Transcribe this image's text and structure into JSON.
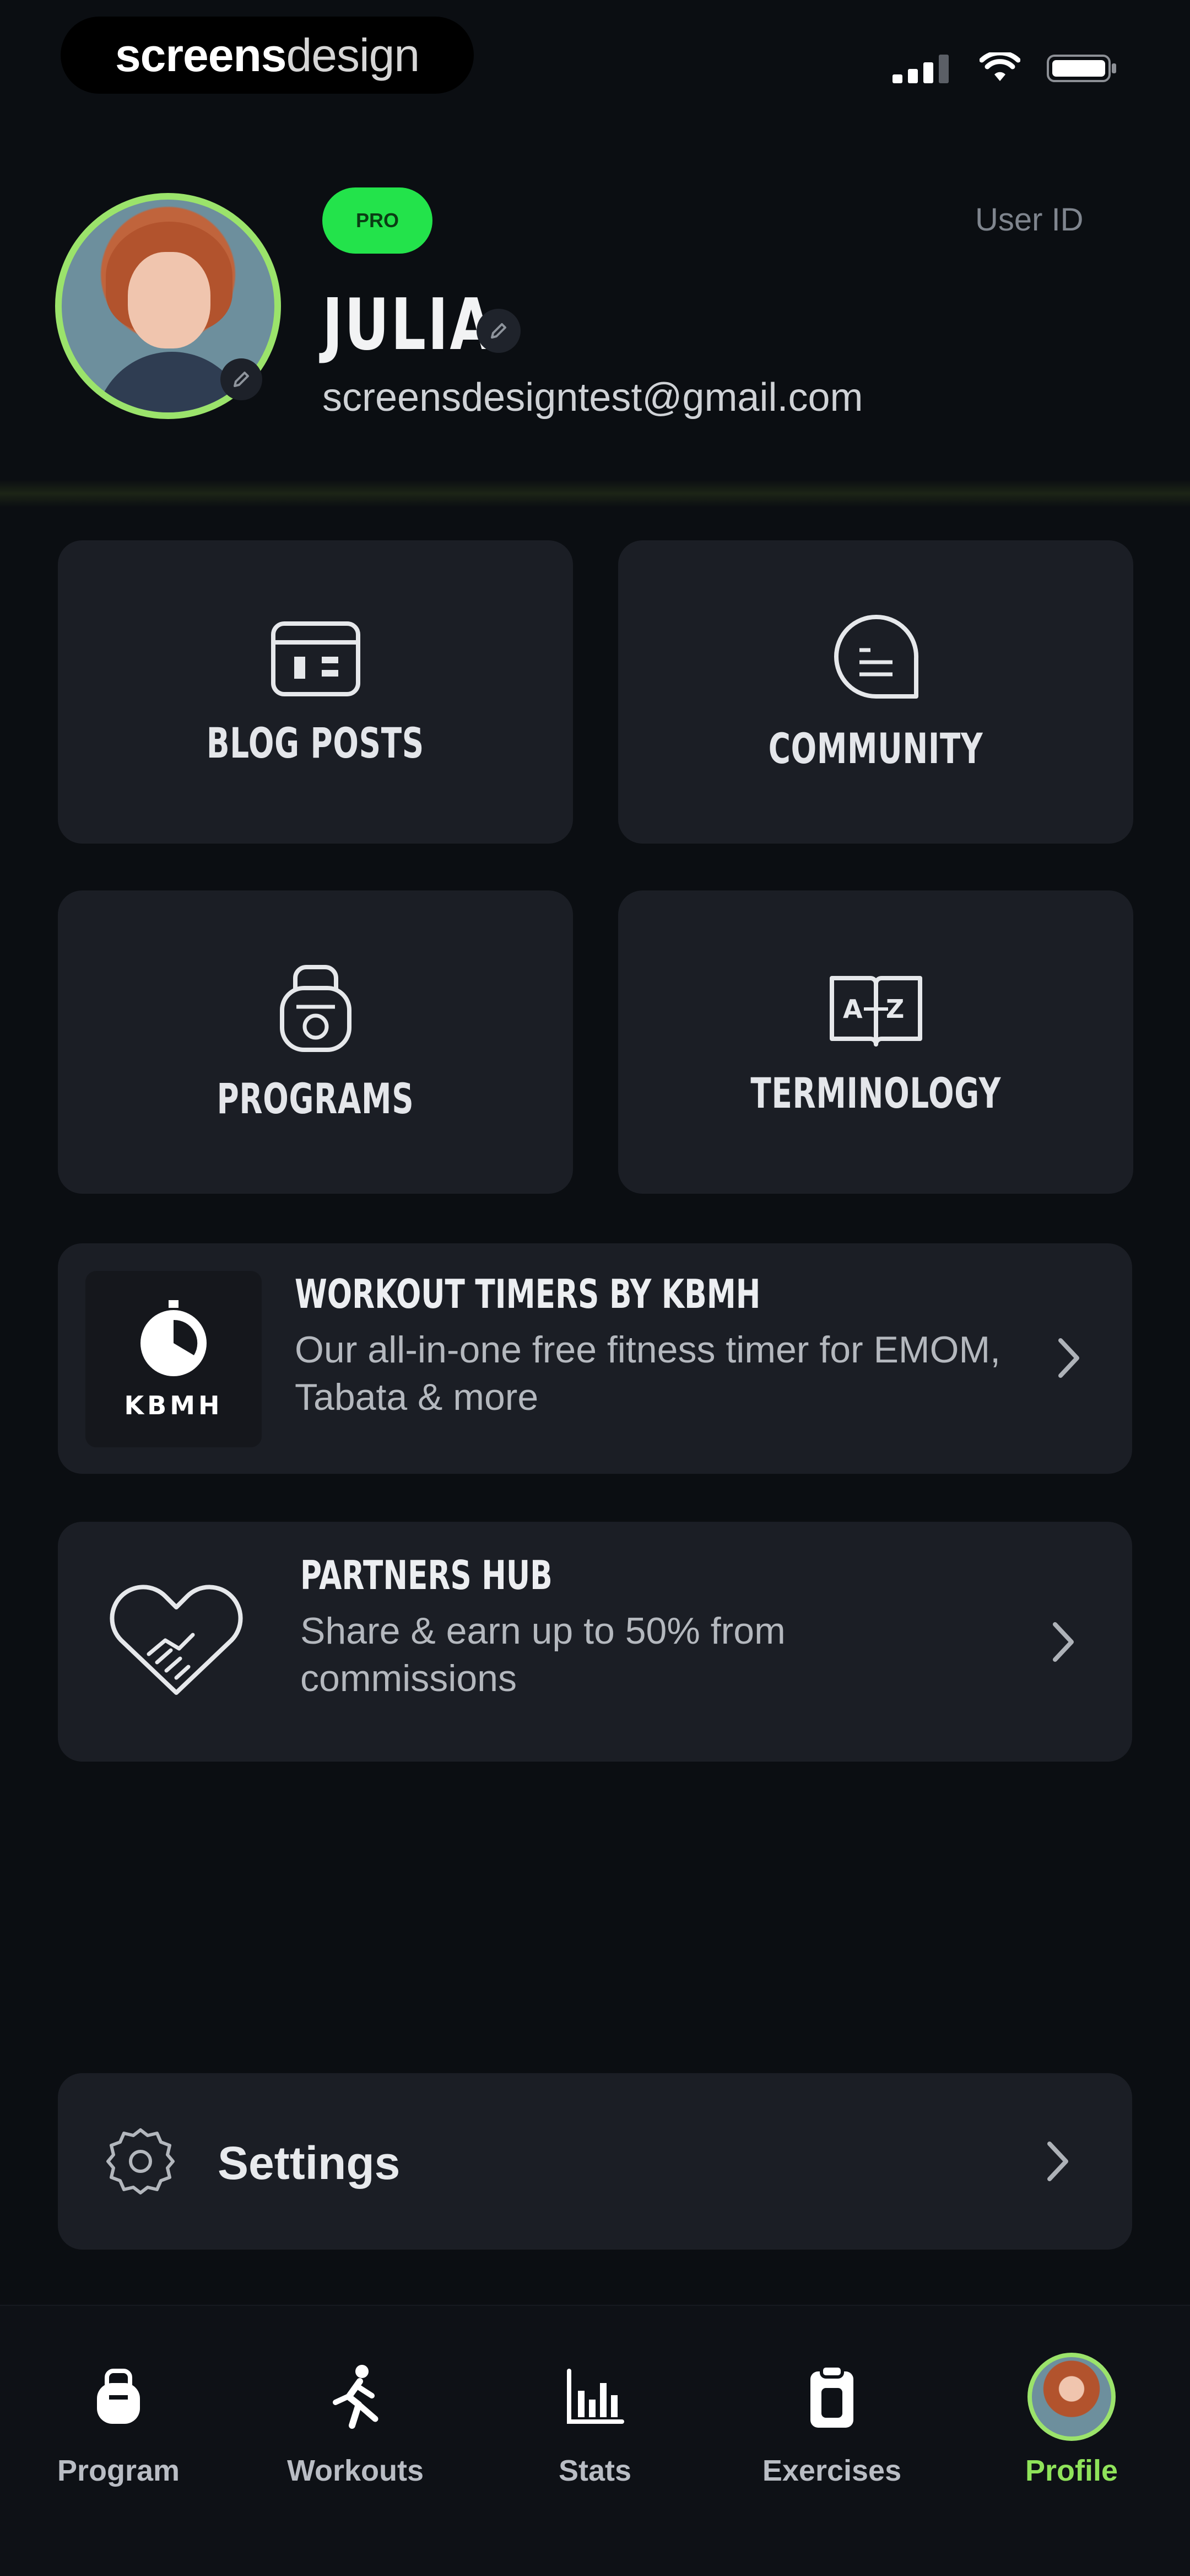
{
  "status_bar": {
    "brand_part1": "screens",
    "brand_part2": "design"
  },
  "profile": {
    "badge": "PRO",
    "user_id_label": "User ID",
    "name": "JULIA",
    "email": "screensdesigntest@gmail.com"
  },
  "tiles": [
    {
      "label": "BLOG POSTS",
      "icon": "calendar-icon"
    },
    {
      "label": "COMMUNITY",
      "icon": "chat-bubble-icon"
    },
    {
      "label": "PROGRAMS",
      "icon": "kettlebell-icon"
    },
    {
      "label": "TERMINOLOGY",
      "icon": "dictionary-book-icon"
    }
  ],
  "cards": {
    "timers": {
      "title": "WORKOUT TIMERS BY KBMH",
      "subtitle": "Our all-in-one free fitness timer for EMOM, Tabata & more",
      "logo_text": "KBMH"
    },
    "partners": {
      "title": "PARTNERS HUB",
      "subtitle": "Share & earn up to 50% from commissions"
    }
  },
  "settings": {
    "label": "Settings"
  },
  "nav": [
    {
      "label": "Program",
      "icon": "kettlebell-icon",
      "active": false
    },
    {
      "label": "Workouts",
      "icon": "runner-icon",
      "active": false
    },
    {
      "label": "Stats",
      "icon": "bar-chart-icon",
      "active": false
    },
    {
      "label": "Exercises",
      "icon": "clipboard-icon",
      "active": false
    },
    {
      "label": "Profile",
      "icon": "avatar",
      "active": true
    }
  ],
  "colors": {
    "background": "#0b0e12",
    "card": "#1b1e25",
    "accent_green": "#23e34b",
    "active_nav": "#8fe35a"
  }
}
